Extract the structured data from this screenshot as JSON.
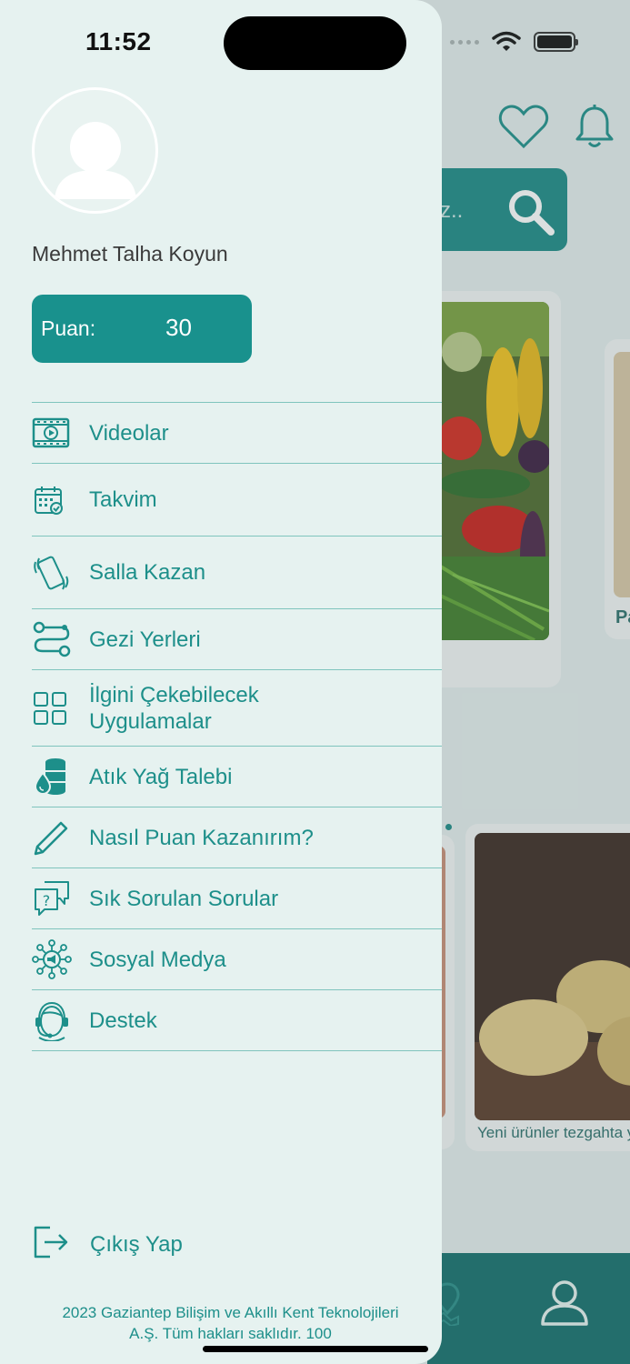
{
  "status_bar": {
    "time": "11:52"
  },
  "profile": {
    "name": "Mehmet Talha Koyun"
  },
  "score": {
    "label": "Puan:",
    "value": "30"
  },
  "menu": [
    {
      "label": "Videolar",
      "icon": "video-icon"
    },
    {
      "label": "Takvim",
      "icon": "calendar-icon"
    },
    {
      "label": "Salla Kazan",
      "icon": "shake-phone-icon"
    },
    {
      "label": "Gezi Yerleri",
      "icon": "route-icon"
    },
    {
      "label": "İlgini Çekebilecek Uygulamalar",
      "icon": "apps-grid-icon"
    },
    {
      "label": "Atık Yağ Talebi",
      "icon": "oil-barrel-icon"
    },
    {
      "label": "Nasıl Puan Kazanırım?",
      "icon": "pencil-icon"
    },
    {
      "label": "Sık Sorulan Sorular",
      "icon": "faq-icon"
    },
    {
      "label": "Sosyal Medya",
      "icon": "social-media-icon"
    },
    {
      "label": "Destek",
      "icon": "support-icon"
    }
  ],
  "logout": {
    "label": "Çıkış Yap",
    "icon": "logout-icon"
  },
  "footer": {
    "line1": "2023 Gaziantep Bilişim ve Akıllı Kent Teknolojileri",
    "line2": "A.Ş. Tüm hakları saklıdır. 100"
  },
  "background": {
    "search_placeholder_fragment": "z..",
    "card_title_partial": "Pa",
    "news_title_partial": "Yeni ürünler tezgahta y"
  },
  "colors": {
    "accent": "#19918d",
    "accent_text": "#1d8f8a",
    "drawer_bg": "#e6f2f0",
    "dark_teal": "#146f6c"
  }
}
